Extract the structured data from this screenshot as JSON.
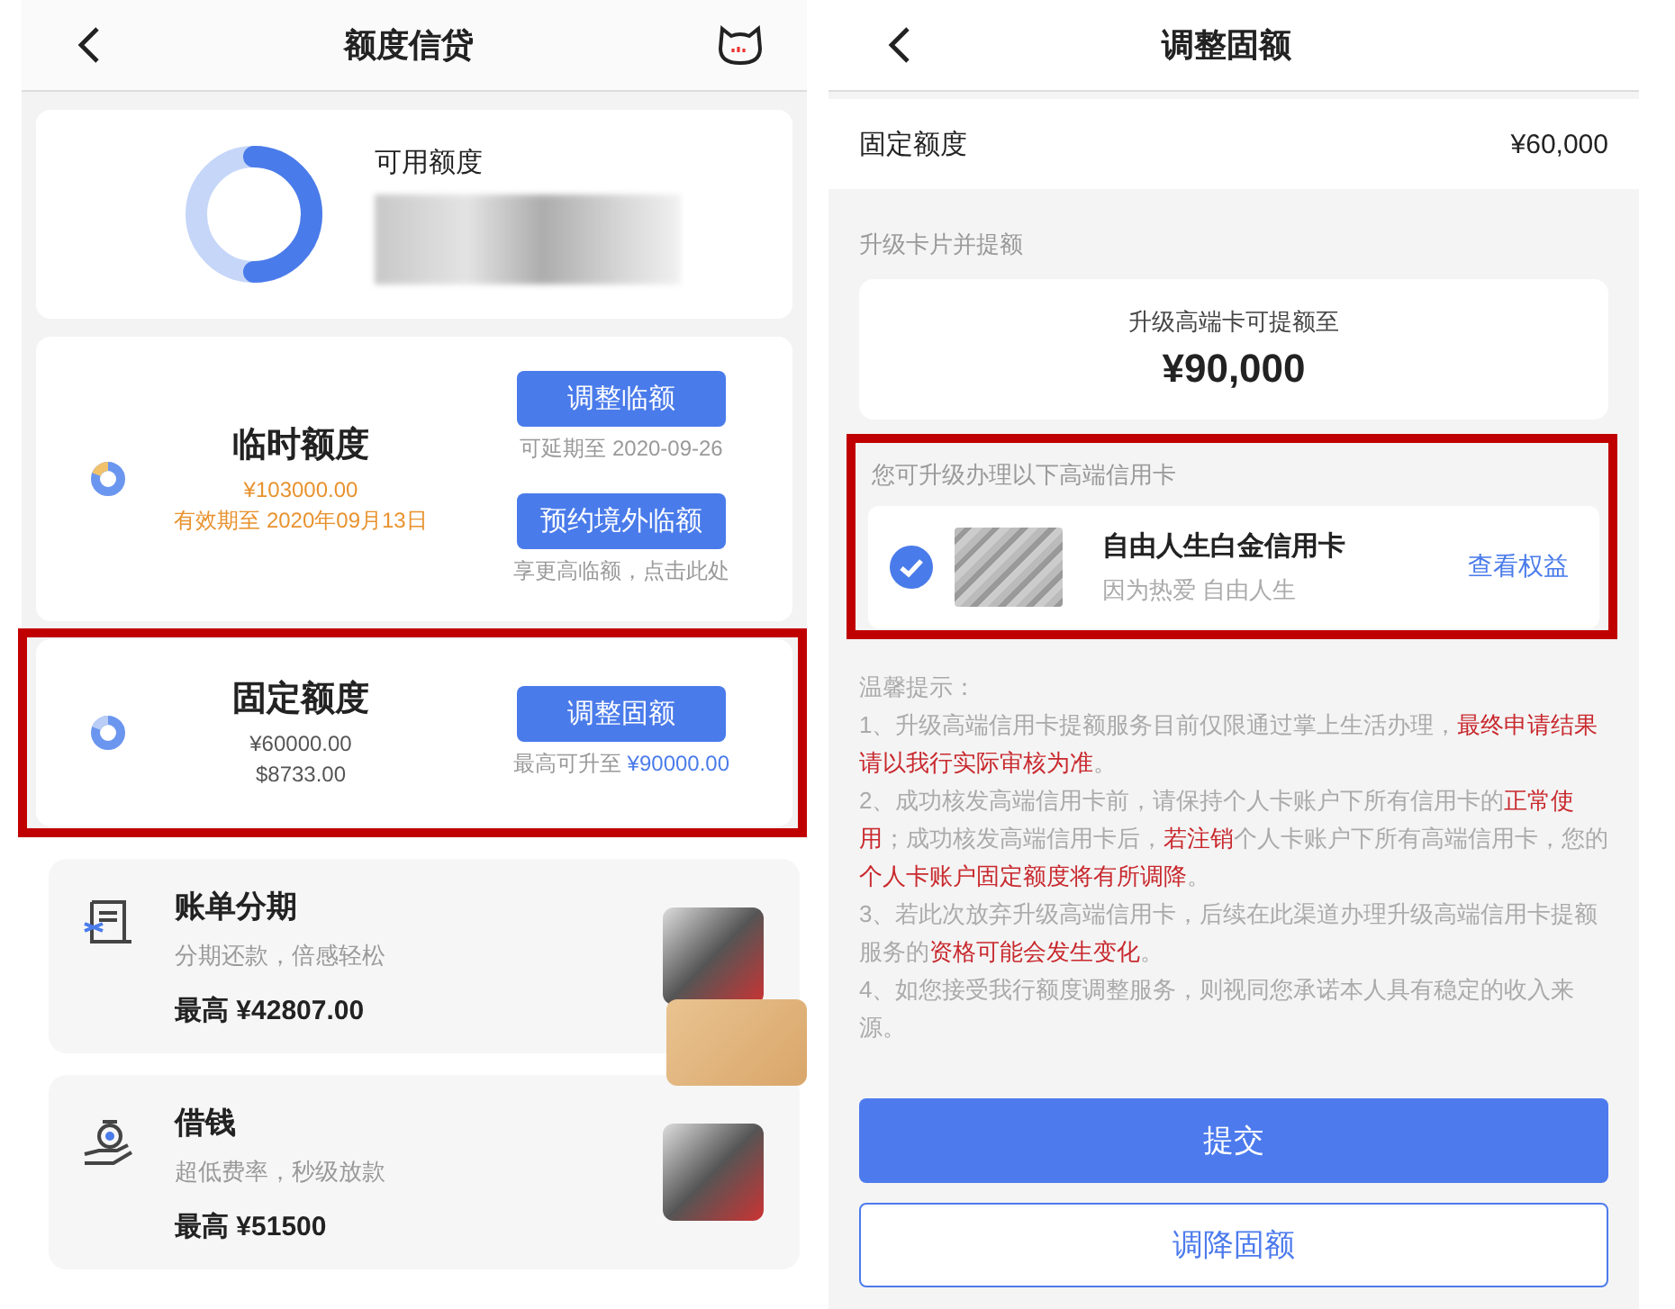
{
  "left": {
    "header": {
      "title": "额度信贷"
    },
    "available": {
      "label": "可用额度"
    },
    "credit_cards": [
      {
        "kind": "temporary",
        "title": "临时额度",
        "amounts": [
          "¥103000.00"
        ],
        "validity": "有效期至 2020年09月13日",
        "highlighted": false,
        "actions": [
          {
            "button": "调整临额",
            "note": "可延期至 2020-09-26"
          },
          {
            "button": "预约境外临额",
            "note": "享更高临额，点击此处"
          }
        ]
      },
      {
        "kind": "fixed",
        "title": "固定额度",
        "amounts": [
          "¥60000.00",
          "$8733.00"
        ],
        "highlighted": true,
        "actions": [
          {
            "button": "调整固额",
            "note": "最高可升至 ",
            "note_amount": "¥90000.00"
          }
        ]
      }
    ],
    "services": [
      {
        "kind": "installment",
        "title": "账单分期",
        "subtitle": "分期还款，倍感轻松",
        "max_label": "最高",
        "max_amount": "¥42807.00"
      },
      {
        "kind": "loan",
        "title": "借钱",
        "subtitle": "超低费率，秒级放款",
        "max_label": "最高",
        "max_amount": "¥51500"
      }
    ]
  },
  "right": {
    "header": {
      "title": "调整固额"
    },
    "fixed_row": {
      "label": "固定额度",
      "value": "¥60,000"
    },
    "upgrade": {
      "section_label": "升级卡片并提额",
      "caption": "升级高端卡可提额至",
      "amount": "¥90,000"
    },
    "card_options": {
      "label": "您可升级办理以下高端信用卡",
      "highlighted": true,
      "items": [
        {
          "name": "自由人生白金信用卡",
          "slogan": "因为热爱 自由人生",
          "link": "查看权益",
          "selected": true
        }
      ]
    },
    "notes": {
      "title": "温馨提示：",
      "items": [
        {
          "segments": [
            {
              "text": "1、升级高端信用卡提额服务目前仅限通过掌上生活办理，",
              "emphasis": false
            },
            {
              "text": "最终申请结果请以我行实际审核为准",
              "emphasis": true
            },
            {
              "text": "。",
              "emphasis": false
            }
          ]
        },
        {
          "segments": [
            {
              "text": "2、成功核发高端信用卡前，请保持个人卡账户下所有信用卡的",
              "emphasis": false
            },
            {
              "text": "正常使用",
              "emphasis": true
            },
            {
              "text": "；成功核发高端信用卡后，",
              "emphasis": false
            },
            {
              "text": "若注销",
              "emphasis": true
            },
            {
              "text": "个人卡账户下所有高端信用卡，您的",
              "emphasis": false
            },
            {
              "text": "个人卡账户固定额度将有所调降",
              "emphasis": true
            },
            {
              "text": "。",
              "emphasis": false
            }
          ]
        },
        {
          "segments": [
            {
              "text": "3、若此次放弃升级高端信用卡，后续在此渠道办理升级高端信用卡提额服务的",
              "emphasis": false
            },
            {
              "text": "资格可能会发生变化",
              "emphasis": true
            },
            {
              "text": "。",
              "emphasis": false
            }
          ]
        },
        {
          "segments": [
            {
              "text": "4、如您接受我行额度调整服务，则视同您承诺本人具有稳定的收入来源。",
              "emphasis": false
            }
          ]
        }
      ]
    },
    "buttons": [
      {
        "kind": "primary",
        "label": "提交"
      },
      {
        "kind": "secondary",
        "label": "调降固额"
      }
    ]
  }
}
